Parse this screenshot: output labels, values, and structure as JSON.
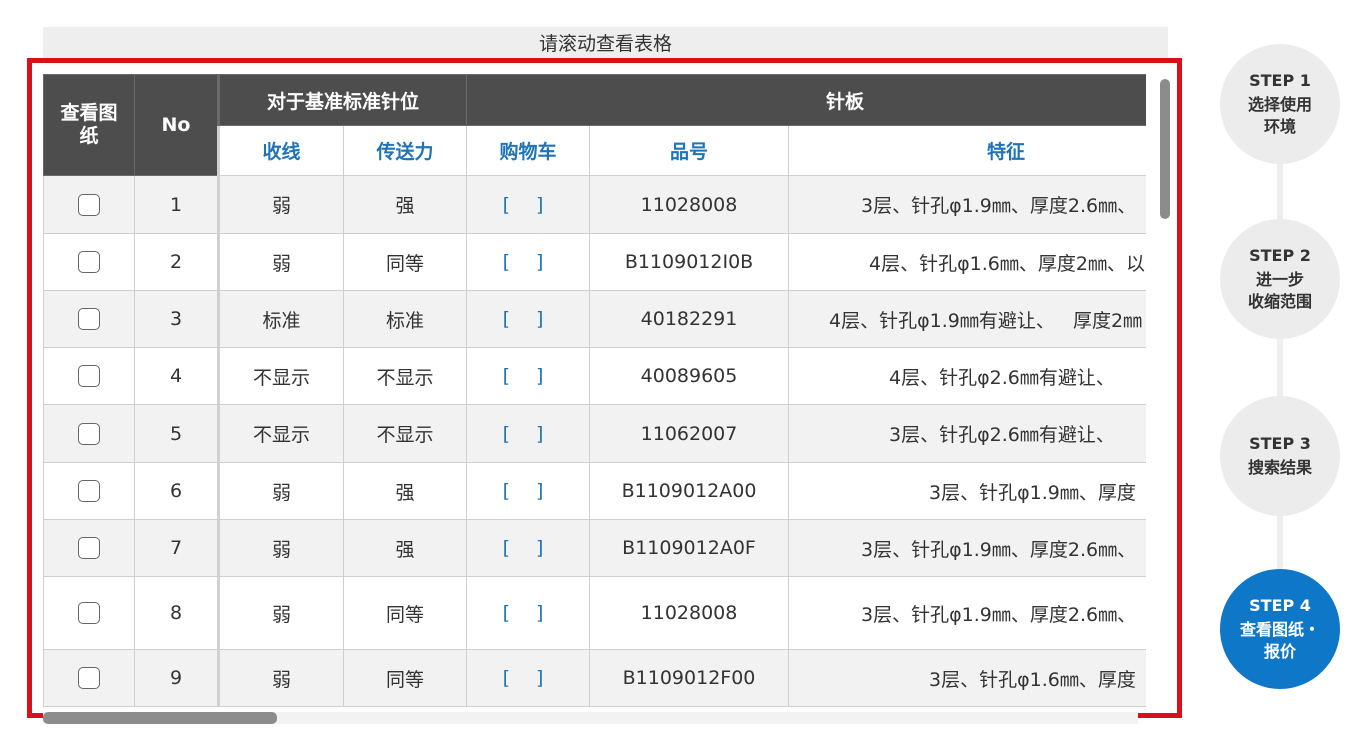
{
  "scroll_hint": "请滚动查看表格",
  "table": {
    "header_group_view": "查看图纸",
    "header_no": "No",
    "header_group_baseline": "对于基准标准针位",
    "header_group_needleplate": "针板",
    "sub_headers": [
      "收线",
      "传送力",
      "购物车",
      "品号",
      "特征"
    ],
    "rows": [
      {
        "no": "1",
        "shouxian": "弱",
        "chuansong": "强",
        "cart": "[ ]",
        "part": "11028008",
        "feature": "3层、针孔φ1.9㎜、厚度2.6㎜、"
      },
      {
        "no": "2",
        "shouxian": "弱",
        "chuansong": "同等",
        "cart": "[ ]",
        "part": "B1109012I0B",
        "feature": "4层、针孔φ1.6㎜、厚度2㎜、以"
      },
      {
        "no": "3",
        "shouxian": "标准",
        "chuansong": "标准",
        "cart": "[ ]",
        "part": "40182291",
        "feature": "4层、针孔φ1.9㎜有避让、   厚度2㎜"
      },
      {
        "no": "4",
        "shouxian": "不显示",
        "chuansong": "不显示",
        "cart": "[ ]",
        "part": "40089605",
        "feature": "4层、针孔φ2.6㎜有避让、"
      },
      {
        "no": "5",
        "shouxian": "不显示",
        "chuansong": "不显示",
        "cart": "[ ]",
        "part": "11062007",
        "feature": "3层、针孔φ2.6㎜有避让、"
      },
      {
        "no": "6",
        "shouxian": "弱",
        "chuansong": "强",
        "cart": "[ ]",
        "part": "B1109012A00",
        "feature": "3层、针孔φ1.9㎜、厚度"
      },
      {
        "no": "7",
        "shouxian": "弱",
        "chuansong": "强",
        "cart": "[ ]",
        "part": "B1109012A0F",
        "feature": "3层、针孔φ1.9㎜、厚度2.6㎜、"
      },
      {
        "no": "8",
        "shouxian": "弱",
        "chuansong": "同等",
        "cart": "[ ]",
        "part": "11028008",
        "feature": "3层、针孔φ1.9㎜、厚度2.6㎜、"
      },
      {
        "no": "9",
        "shouxian": "弱",
        "chuansong": "同等",
        "cart": "[ ]",
        "part": "B1109012F00",
        "feature": "3层、针孔φ1.6㎜、厚度"
      }
    ]
  },
  "steps": [
    {
      "num": "STEP 1",
      "label": "选择使用\n环境",
      "active": false
    },
    {
      "num": "STEP 2",
      "label": "进一步\n收缩范围",
      "active": false
    },
    {
      "num": "STEP 3",
      "label": "搜索结果",
      "active": false
    },
    {
      "num": "STEP 4",
      "label": "查看图纸・\n报价",
      "active": true
    }
  ]
}
